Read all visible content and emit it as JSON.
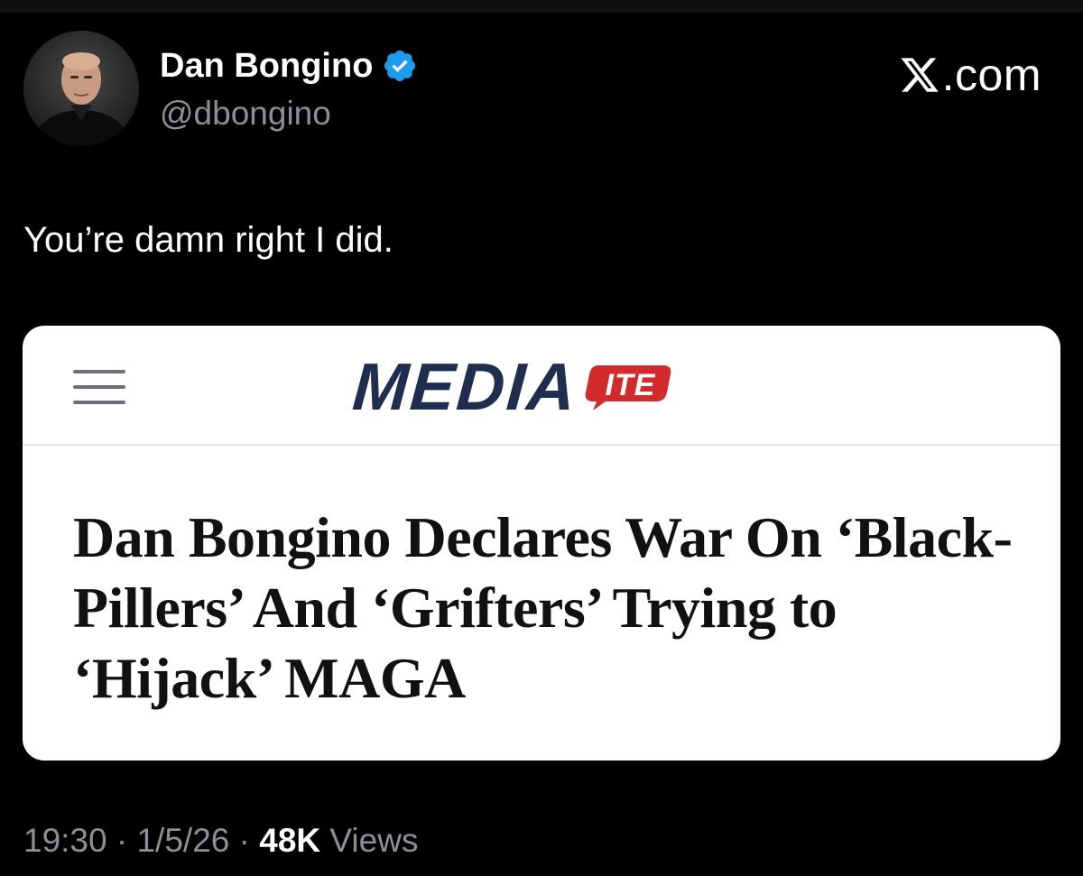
{
  "author": {
    "display_name": "Dan Bongino",
    "handle": "@dbongino",
    "verified": true,
    "verified_color": "#1d9bf0"
  },
  "brand": {
    "label": ".com"
  },
  "tweet": {
    "text": "You’re damn right I did."
  },
  "card": {
    "site_logo_main": "MEDIA",
    "site_logo_suffix": "ITE",
    "logo_color": "#1f2d4f",
    "logo_accent": "#d12b2b",
    "menu_icon": "hamburger-icon",
    "headline": "Dan Bongino Declares War On ‘Black-Pillers’ And ‘Grifters’ Trying to ‘Hijack’ MAGA"
  },
  "meta": {
    "time": "19:30",
    "separator": " · ",
    "date": "1/5/26",
    "views_count": "48K",
    "views_label": " Views"
  }
}
